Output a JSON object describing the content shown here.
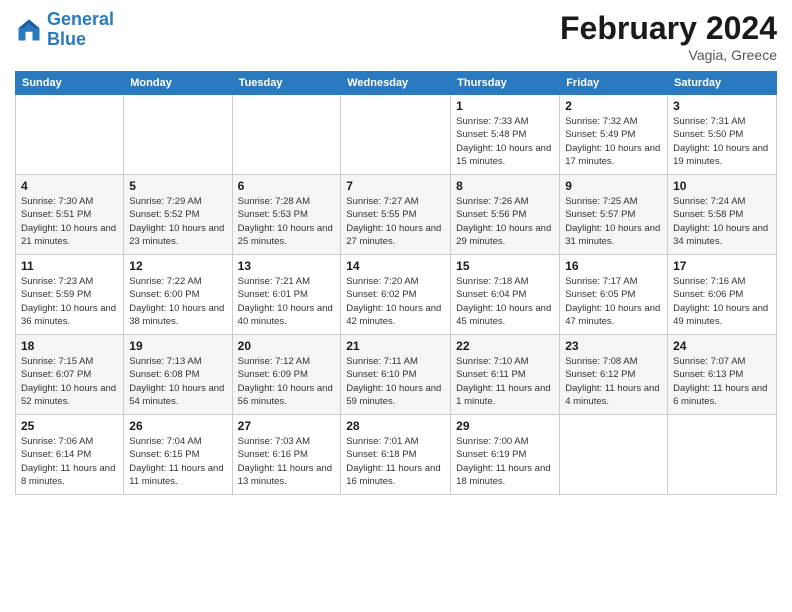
{
  "logo": {
    "general": "General",
    "blue": "Blue"
  },
  "header": {
    "title": "February 2024",
    "location": "Vagia, Greece"
  },
  "weekdays": [
    "Sunday",
    "Monday",
    "Tuesday",
    "Wednesday",
    "Thursday",
    "Friday",
    "Saturday"
  ],
  "weeks": [
    [
      {
        "day": "",
        "sunrise": "",
        "sunset": "",
        "daylight": ""
      },
      {
        "day": "",
        "sunrise": "",
        "sunset": "",
        "daylight": ""
      },
      {
        "day": "",
        "sunrise": "",
        "sunset": "",
        "daylight": ""
      },
      {
        "day": "",
        "sunrise": "",
        "sunset": "",
        "daylight": ""
      },
      {
        "day": "1",
        "sunrise": "Sunrise: 7:33 AM",
        "sunset": "Sunset: 5:48 PM",
        "daylight": "Daylight: 10 hours and 15 minutes."
      },
      {
        "day": "2",
        "sunrise": "Sunrise: 7:32 AM",
        "sunset": "Sunset: 5:49 PM",
        "daylight": "Daylight: 10 hours and 17 minutes."
      },
      {
        "day": "3",
        "sunrise": "Sunrise: 7:31 AM",
        "sunset": "Sunset: 5:50 PM",
        "daylight": "Daylight: 10 hours and 19 minutes."
      }
    ],
    [
      {
        "day": "4",
        "sunrise": "Sunrise: 7:30 AM",
        "sunset": "Sunset: 5:51 PM",
        "daylight": "Daylight: 10 hours and 21 minutes."
      },
      {
        "day": "5",
        "sunrise": "Sunrise: 7:29 AM",
        "sunset": "Sunset: 5:52 PM",
        "daylight": "Daylight: 10 hours and 23 minutes."
      },
      {
        "day": "6",
        "sunrise": "Sunrise: 7:28 AM",
        "sunset": "Sunset: 5:53 PM",
        "daylight": "Daylight: 10 hours and 25 minutes."
      },
      {
        "day": "7",
        "sunrise": "Sunrise: 7:27 AM",
        "sunset": "Sunset: 5:55 PM",
        "daylight": "Daylight: 10 hours and 27 minutes."
      },
      {
        "day": "8",
        "sunrise": "Sunrise: 7:26 AM",
        "sunset": "Sunset: 5:56 PM",
        "daylight": "Daylight: 10 hours and 29 minutes."
      },
      {
        "day": "9",
        "sunrise": "Sunrise: 7:25 AM",
        "sunset": "Sunset: 5:57 PM",
        "daylight": "Daylight: 10 hours and 31 minutes."
      },
      {
        "day": "10",
        "sunrise": "Sunrise: 7:24 AM",
        "sunset": "Sunset: 5:58 PM",
        "daylight": "Daylight: 10 hours and 34 minutes."
      }
    ],
    [
      {
        "day": "11",
        "sunrise": "Sunrise: 7:23 AM",
        "sunset": "Sunset: 5:59 PM",
        "daylight": "Daylight: 10 hours and 36 minutes."
      },
      {
        "day": "12",
        "sunrise": "Sunrise: 7:22 AM",
        "sunset": "Sunset: 6:00 PM",
        "daylight": "Daylight: 10 hours and 38 minutes."
      },
      {
        "day": "13",
        "sunrise": "Sunrise: 7:21 AM",
        "sunset": "Sunset: 6:01 PM",
        "daylight": "Daylight: 10 hours and 40 minutes."
      },
      {
        "day": "14",
        "sunrise": "Sunrise: 7:20 AM",
        "sunset": "Sunset: 6:02 PM",
        "daylight": "Daylight: 10 hours and 42 minutes."
      },
      {
        "day": "15",
        "sunrise": "Sunrise: 7:18 AM",
        "sunset": "Sunset: 6:04 PM",
        "daylight": "Daylight: 10 hours and 45 minutes."
      },
      {
        "day": "16",
        "sunrise": "Sunrise: 7:17 AM",
        "sunset": "Sunset: 6:05 PM",
        "daylight": "Daylight: 10 hours and 47 minutes."
      },
      {
        "day": "17",
        "sunrise": "Sunrise: 7:16 AM",
        "sunset": "Sunset: 6:06 PM",
        "daylight": "Daylight: 10 hours and 49 minutes."
      }
    ],
    [
      {
        "day": "18",
        "sunrise": "Sunrise: 7:15 AM",
        "sunset": "Sunset: 6:07 PM",
        "daylight": "Daylight: 10 hours and 52 minutes."
      },
      {
        "day": "19",
        "sunrise": "Sunrise: 7:13 AM",
        "sunset": "Sunset: 6:08 PM",
        "daylight": "Daylight: 10 hours and 54 minutes."
      },
      {
        "day": "20",
        "sunrise": "Sunrise: 7:12 AM",
        "sunset": "Sunset: 6:09 PM",
        "daylight": "Daylight: 10 hours and 56 minutes."
      },
      {
        "day": "21",
        "sunrise": "Sunrise: 7:11 AM",
        "sunset": "Sunset: 6:10 PM",
        "daylight": "Daylight: 10 hours and 59 minutes."
      },
      {
        "day": "22",
        "sunrise": "Sunrise: 7:10 AM",
        "sunset": "Sunset: 6:11 PM",
        "daylight": "Daylight: 11 hours and 1 minute."
      },
      {
        "day": "23",
        "sunrise": "Sunrise: 7:08 AM",
        "sunset": "Sunset: 6:12 PM",
        "daylight": "Daylight: 11 hours and 4 minutes."
      },
      {
        "day": "24",
        "sunrise": "Sunrise: 7:07 AM",
        "sunset": "Sunset: 6:13 PM",
        "daylight": "Daylight: 11 hours and 6 minutes."
      }
    ],
    [
      {
        "day": "25",
        "sunrise": "Sunrise: 7:06 AM",
        "sunset": "Sunset: 6:14 PM",
        "daylight": "Daylight: 11 hours and 8 minutes."
      },
      {
        "day": "26",
        "sunrise": "Sunrise: 7:04 AM",
        "sunset": "Sunset: 6:15 PM",
        "daylight": "Daylight: 11 hours and 11 minutes."
      },
      {
        "day": "27",
        "sunrise": "Sunrise: 7:03 AM",
        "sunset": "Sunset: 6:16 PM",
        "daylight": "Daylight: 11 hours and 13 minutes."
      },
      {
        "day": "28",
        "sunrise": "Sunrise: 7:01 AM",
        "sunset": "Sunset: 6:18 PM",
        "daylight": "Daylight: 11 hours and 16 minutes."
      },
      {
        "day": "29",
        "sunrise": "Sunrise: 7:00 AM",
        "sunset": "Sunset: 6:19 PM",
        "daylight": "Daylight: 11 hours and 18 minutes."
      },
      {
        "day": "",
        "sunrise": "",
        "sunset": "",
        "daylight": ""
      },
      {
        "day": "",
        "sunrise": "",
        "sunset": "",
        "daylight": ""
      }
    ]
  ]
}
